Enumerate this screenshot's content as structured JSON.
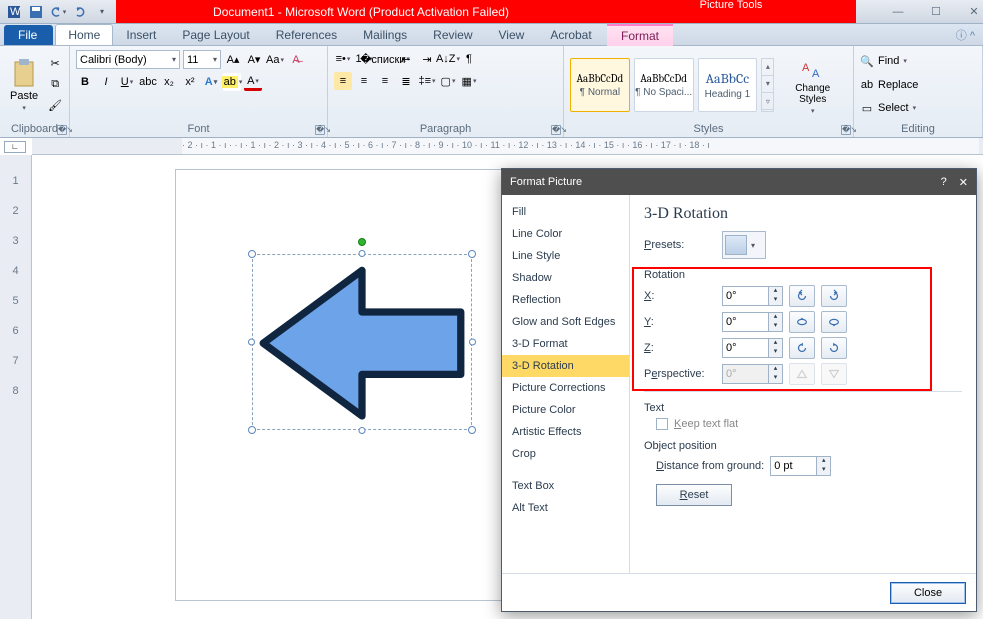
{
  "window": {
    "title": "Document1 - Microsoft Word (Product Activation Failed)",
    "contextual_tab_group": "Picture Tools"
  },
  "tabs": {
    "file": "File",
    "items": [
      "Home",
      "Insert",
      "Page Layout",
      "References",
      "Mailings",
      "Review",
      "View",
      "Acrobat"
    ],
    "active": "Home",
    "format": "Format"
  },
  "ribbon": {
    "clipboard": {
      "label": "Clipboard",
      "paste": "Paste"
    },
    "font": {
      "label": "Font",
      "name": "Calibri (Body)",
      "size": "11"
    },
    "paragraph": {
      "label": "Paragraph"
    },
    "styles": {
      "label": "Styles",
      "samples": [
        "AaBbCcDd",
        "AaBbCcDd",
        "AaBbCc"
      ],
      "names": [
        "¶ Normal",
        "¶ No Spaci...",
        "Heading 1"
      ],
      "change": "Change Styles"
    },
    "editing": {
      "label": "Editing",
      "find": "Find",
      "replace": "Replace",
      "select": "Select"
    }
  },
  "ruler_text": " · 2 · ı · 1 · ı ·     · ı · 1 · ı · 2 · ı · 3 · ı · 4 · ı · 5 · ı · 6 · ı · 7 · ı · 8 · ı · 9 · ı · 10 · ı · 11 · ı · 12 · ı · 13 · ı · 14 · ı · 15 · ı · 16 · ı · 17 · ı · 18 · ı",
  "ruler_v": [
    "1",
    "2",
    "3",
    "4",
    "5",
    "6",
    "7",
    "8"
  ],
  "dialog": {
    "title": "Format Picture",
    "nav": [
      "Fill",
      "Line Color",
      "Line Style",
      "Shadow",
      "Reflection",
      "Glow and Soft Edges",
      "3-D Format",
      "3-D Rotation",
      "Picture Corrections",
      "Picture Color",
      "Artistic Effects",
      "Crop",
      "Text Box",
      "Alt Text"
    ],
    "nav_selected": "3-D Rotation",
    "pane": {
      "heading": "3-D Rotation",
      "presets_label": "Presets:",
      "rotation_label": "Rotation",
      "x_label": "X:",
      "x_val": "0°",
      "y_label": "Y:",
      "y_val": "0°",
      "z_label": "Z:",
      "z_val": "0°",
      "persp_label": "Perspective:",
      "persp_val": "0°",
      "text_label": "Text",
      "keep_flat": "Keep text flat",
      "objpos_label": "Object position",
      "dist_label": "Distance from ground:",
      "dist_val": "0 pt",
      "reset": "Reset"
    },
    "close": "Close"
  }
}
